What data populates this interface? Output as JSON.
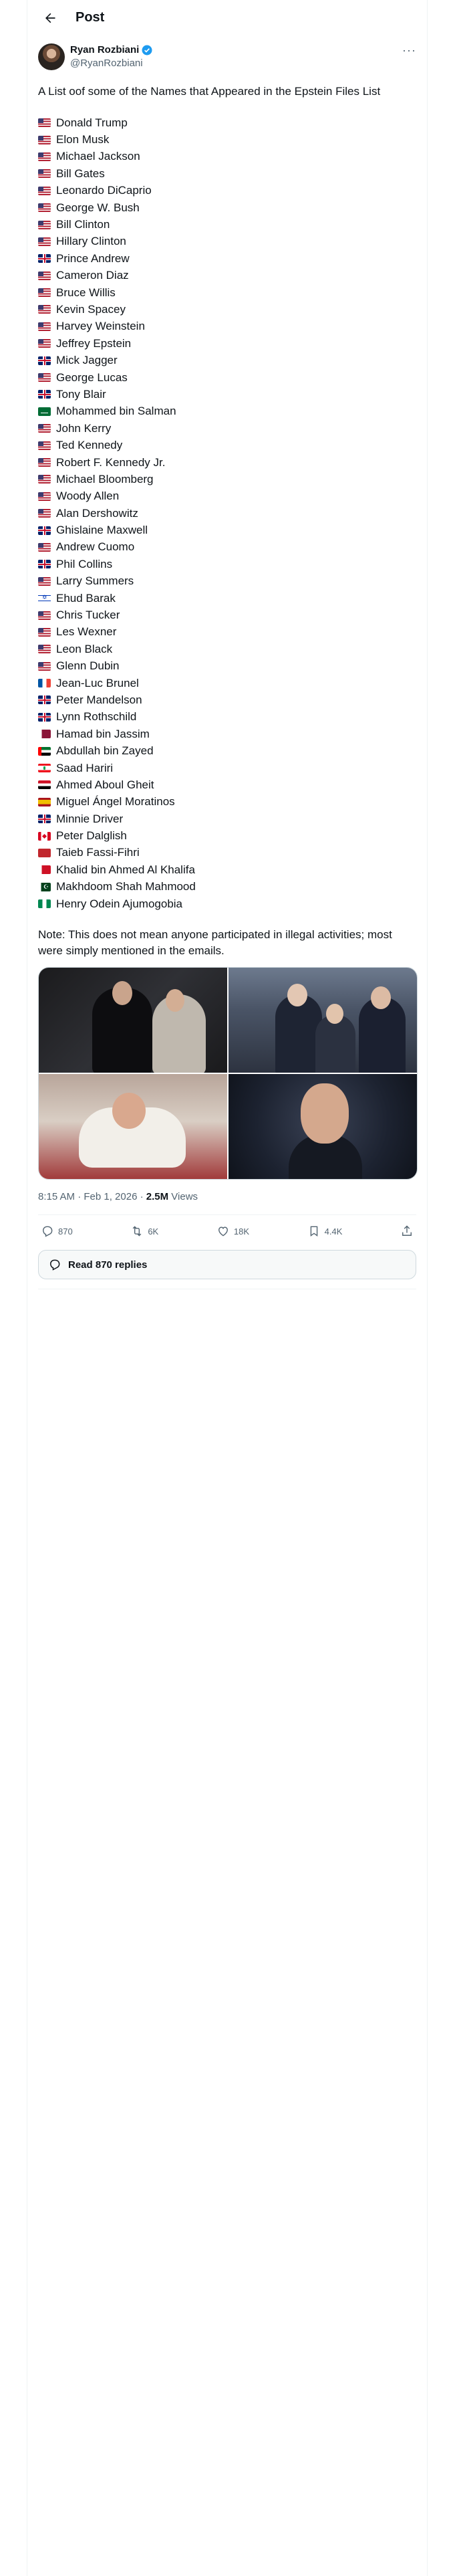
{
  "header": {
    "title": "Post"
  },
  "author": {
    "name": "Ryan Rozbiani",
    "handle": "@RyanRozbiani",
    "verified_color": "#1d9bf0"
  },
  "tweet": {
    "title": "A List oof some of the Names that Appeared in the Epstein Files List",
    "names": [
      {
        "flag": "us",
        "name": "Donald Trump"
      },
      {
        "flag": "us",
        "name": "Elon Musk"
      },
      {
        "flag": "us",
        "name": "Michael Jackson"
      },
      {
        "flag": "us",
        "name": "Bill Gates"
      },
      {
        "flag": "us",
        "name": "Leonardo DiCaprio"
      },
      {
        "flag": "us",
        "name": "George W. Bush"
      },
      {
        "flag": "us",
        "name": "Bill Clinton"
      },
      {
        "flag": "us",
        "name": "Hillary Clinton"
      },
      {
        "flag": "uk",
        "name": "Prince Andrew"
      },
      {
        "flag": "us",
        "name": "Cameron Diaz"
      },
      {
        "flag": "us",
        "name": "Bruce Willis"
      },
      {
        "flag": "us",
        "name": "Kevin Spacey"
      },
      {
        "flag": "us",
        "name": "Harvey Weinstein"
      },
      {
        "flag": "us",
        "name": "Jeffrey Epstein"
      },
      {
        "flag": "uk",
        "name": "Mick Jagger"
      },
      {
        "flag": "us",
        "name": "George Lucas"
      },
      {
        "flag": "uk",
        "name": "Tony Blair"
      },
      {
        "flag": "sa",
        "name": "Mohammed bin Salman"
      },
      {
        "flag": "us",
        "name": "John Kerry"
      },
      {
        "flag": "us",
        "name": "Ted Kennedy"
      },
      {
        "flag": "us",
        "name": "Robert F. Kennedy Jr."
      },
      {
        "flag": "us",
        "name": "Michael Bloomberg"
      },
      {
        "flag": "us",
        "name": "Woody Allen"
      },
      {
        "flag": "us",
        "name": "Alan Dershowitz"
      },
      {
        "flag": "uk",
        "name": "Ghislaine Maxwell"
      },
      {
        "flag": "us",
        "name": "Andrew Cuomo"
      },
      {
        "flag": "uk",
        "name": "Phil Collins"
      },
      {
        "flag": "us",
        "name": "Larry Summers"
      },
      {
        "flag": "il",
        "name": "Ehud Barak"
      },
      {
        "flag": "us",
        "name": "Chris Tucker"
      },
      {
        "flag": "us",
        "name": "Les Wexner"
      },
      {
        "flag": "us",
        "name": "Leon Black"
      },
      {
        "flag": "us",
        "name": "Glenn Dubin"
      },
      {
        "flag": "fr",
        "name": "Jean-Luc Brunel"
      },
      {
        "flag": "uk",
        "name": "Peter Mandelson"
      },
      {
        "flag": "uk",
        "name": "Lynn Rothschild"
      },
      {
        "flag": "qa",
        "name": "Hamad bin Jassim"
      },
      {
        "flag": "ae",
        "name": "Abdullah bin Zayed"
      },
      {
        "flag": "lb",
        "name": "Saad Hariri"
      },
      {
        "flag": "eg",
        "name": "Ahmed Aboul Gheit"
      },
      {
        "flag": "es",
        "name": "Miguel Ángel Moratinos"
      },
      {
        "flag": "uk",
        "name": "Minnie Driver"
      },
      {
        "flag": "ca",
        "name": "Peter Dalglish"
      },
      {
        "flag": "ma",
        "name": "Taieb Fassi-Fihri"
      },
      {
        "flag": "bh",
        "name": "Khalid bin Ahmed Al Khalifa"
      },
      {
        "flag": "pk",
        "name": "Makhdoom Shah Mahmood"
      },
      {
        "flag": "ng",
        "name": "Henry Odein Ajumogobia"
      }
    ],
    "note": "Note: This does not mean anyone participated in illegal activities; most were simply mentioned in the emails.",
    "time": "8:15 AM · Feb 1, 2026 · ",
    "views_count": "2.5M",
    "views_label": " Views"
  },
  "actions": {
    "replies": "870",
    "reposts": "6K",
    "likes": "18K",
    "bookmarks": "4.4K"
  },
  "read_replies": "Read 870 replies",
  "colors": {
    "text": "#0f1419",
    "secondary": "#536471",
    "border": "#eff3f4",
    "accent": "#1d9bf0"
  }
}
